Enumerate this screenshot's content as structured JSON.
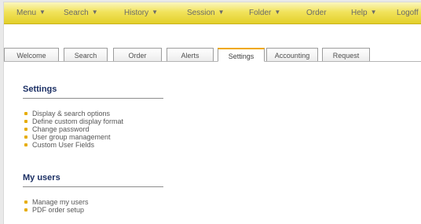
{
  "menu": {
    "items": [
      {
        "label": "Menu",
        "has_caret": true
      },
      {
        "label": "Search",
        "has_caret": true
      },
      {
        "label": "History",
        "has_caret": true
      },
      {
        "label": "Session",
        "has_caret": true
      },
      {
        "label": "Folder",
        "has_caret": true
      },
      {
        "label": "Order",
        "has_caret": false
      },
      {
        "label": "Help",
        "has_caret": true
      },
      {
        "label": "Logoff",
        "has_caret": false
      }
    ],
    "caret_glyph": "▼"
  },
  "tabs": [
    {
      "label": "Welcome",
      "active": false
    },
    {
      "label": "Search",
      "active": false
    },
    {
      "label": "Order",
      "active": false
    },
    {
      "label": "Alerts",
      "active": false
    },
    {
      "label": "Settings",
      "active": true
    },
    {
      "label": "Accounting",
      "active": false
    },
    {
      "label": "Request",
      "active": false
    }
  ],
  "settings": {
    "title": "Settings",
    "links": [
      "Display & search options",
      "Define custom display format",
      "Change password",
      "User group management",
      "Custom User Fields"
    ]
  },
  "my_users": {
    "title": "My users",
    "links": [
      "Manage my users",
      "PDF order setup"
    ]
  },
  "colors": {
    "menu_bar": "#f1e35c",
    "active_tab_accent": "#f0a800",
    "section_title": "#1b2f64",
    "bullet": "#e6ac00"
  }
}
